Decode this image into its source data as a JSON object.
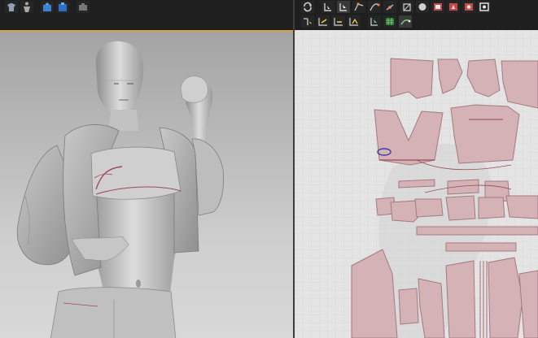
{
  "theme": {
    "accent": "#d6a636",
    "panel": "#1f1f1f",
    "piece_fill": "#d4b2b6",
    "piece_stroke": "#a47a82",
    "stitch": "#9a4b55"
  },
  "left_toolbar": {
    "icons": [
      "garment-icon",
      "avatar-icon",
      "simulate-icon",
      "reset-icon",
      "camera-icon"
    ]
  },
  "right_toolbar": {
    "row1_icons": [
      "refresh-icon",
      "transform-pattern-icon",
      "edit-pattern-icon",
      "edit-point-icon",
      "edit-curvature-icon",
      "add-point-icon",
      "circle-tool-icon",
      "sphere-icon",
      "rectangle-tool-icon",
      "internal-polygon-icon",
      "internal-rectangle-icon",
      "settings-icon"
    ],
    "row2_icons": [
      "segment-sewing-icon",
      "free-sewing-icon",
      "edit-sewing-icon",
      "check-sewing-icon",
      "select-mesh-icon",
      "texture-icon",
      "fold-arrangement-icon"
    ]
  }
}
